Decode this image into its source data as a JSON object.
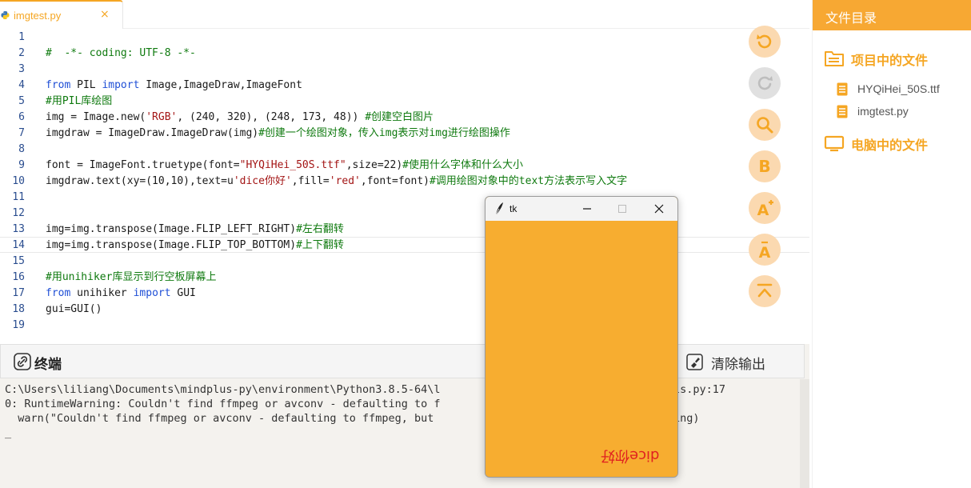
{
  "editor": {
    "tab_label": "imgtest.py",
    "tab_close": "×",
    "lines": [
      {
        "n": "1",
        "html": ""
      },
      {
        "n": "2",
        "html": "<span class=\"cmt\">#  -*- coding: UTF-8 -*-</span>"
      },
      {
        "n": "3",
        "html": ""
      },
      {
        "n": "4",
        "html": "<span class=\"kw\">from</span> PIL <span class=\"kw\">import</span> Image,ImageDraw,ImageFont"
      },
      {
        "n": "5",
        "html": "<span class=\"cmt\">#用PIL库绘图</span>"
      },
      {
        "n": "6",
        "html": "img = Image.new(<span class=\"str\">'RGB'</span>, (240, 320), (248, 173, 48)) <span class=\"cmt\">#创建空白图片</span>"
      },
      {
        "n": "7",
        "html": "imgdraw = ImageDraw.ImageDraw(img)<span class=\"cmt\">#创建一个绘图对象，传入img表示对img进行绘图操作</span>"
      },
      {
        "n": "8",
        "html": ""
      },
      {
        "n": "9",
        "html": "font = ImageFont.truetype(font=<span class=\"str\">\"HYQiHei_50S.ttf\"</span>,size=22)<span class=\"cmt\">#使用什么字体和什么大小</span>"
      },
      {
        "n": "10",
        "html": "imgdraw.text(xy=(10,10),text=u<span class=\"str\">'dice你好'</span>,fill=<span class=\"str\">'red'</span>,font=font)<span class=\"cmt\">#调用绘图对象中的text方法表示写入文字</span>"
      },
      {
        "n": "11",
        "html": ""
      },
      {
        "n": "12",
        "html": ""
      },
      {
        "n": "13",
        "html": "img=img.transpose(Image.FLIP_LEFT_RIGHT)<span class=\"cmt\">#左右翻转</span>"
      },
      {
        "n": "14",
        "html": "img=img.transpose(Image.FLIP_TOP_BOTTOM)<span class=\"cmt\">#上下翻转</span>"
      },
      {
        "n": "15",
        "html": ""
      },
      {
        "n": "16",
        "html": "<span class=\"cmt\">#用unihiker库显示到行空板屏幕上</span>"
      },
      {
        "n": "17",
        "html": "<span class=\"kw\">from</span> unihiker <span class=\"kw\">import</span> GUI"
      },
      {
        "n": "18",
        "html": "gui=GUI()"
      },
      {
        "n": "19",
        "html": ""
      }
    ]
  },
  "tools": [
    {
      "name": "undo-icon",
      "disabled": false
    },
    {
      "name": "redo-icon",
      "disabled": true
    },
    {
      "name": "search-icon",
      "disabled": false
    },
    {
      "name": "bold-b-icon",
      "disabled": false
    },
    {
      "name": "font-increase-icon",
      "disabled": false
    },
    {
      "name": "font-decrease-icon",
      "disabled": false
    },
    {
      "name": "scroll-top-icon",
      "disabled": false
    }
  ],
  "terminal": {
    "title": "终端",
    "clear_label": "清除输出",
    "lines": [
      "C:\\Users\\liliang\\Documents\\mindplus-py\\environment\\Python3.8.5-64\\l",
      "0: RuntimeWarning: Couldn't find ffmpeg or avconv - defaulting to f",
      "  warn(\"Couldn't find ffmpeg or avconv - defaulting to ffmpeg, but",
      "_"
    ],
    "line_tails": [
      "ls.py:17",
      "",
      "ing)",
      ""
    ]
  },
  "file_panel": {
    "title": "文件目录",
    "project_section": "项目中的文件",
    "project_files": [
      "HYQiHei_50S.ttf",
      "imgtest.py"
    ],
    "computer_section": "电脑中的文件"
  },
  "tk_window": {
    "title": "tk",
    "canvas_text": "dice你好",
    "canvas_color": "#f8ad30",
    "text_color": "#ff0000"
  },
  "colors": {
    "accent": "#f7a833"
  }
}
